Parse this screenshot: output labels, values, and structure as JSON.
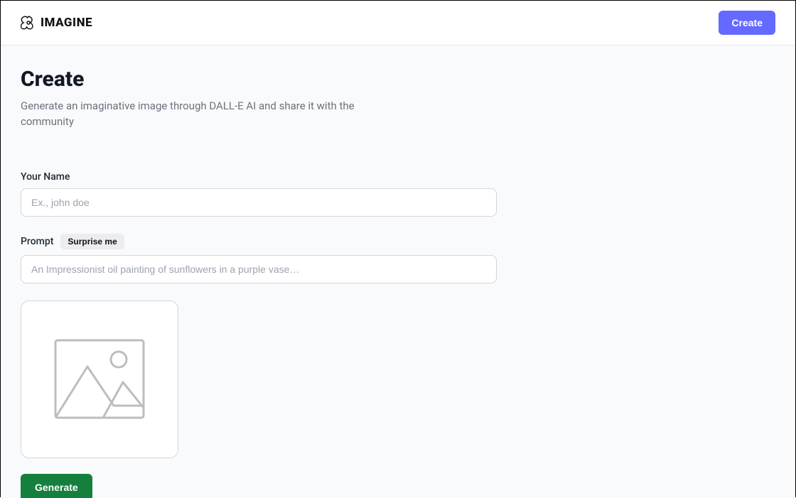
{
  "header": {
    "brand": "IMAGINE",
    "create_label": "Create"
  },
  "page": {
    "title": "Create",
    "subtitle": "Generate an imaginative image through DALL-E AI and share it with the community"
  },
  "form": {
    "name": {
      "label": "Your Name",
      "placeholder": "Ex., john doe",
      "value": ""
    },
    "prompt": {
      "label": "Prompt",
      "surprise_label": "Surprise me",
      "placeholder": "An Impressionist oil painting of sunflowers in a purple vase…",
      "value": ""
    },
    "generate_label": "Generate"
  }
}
